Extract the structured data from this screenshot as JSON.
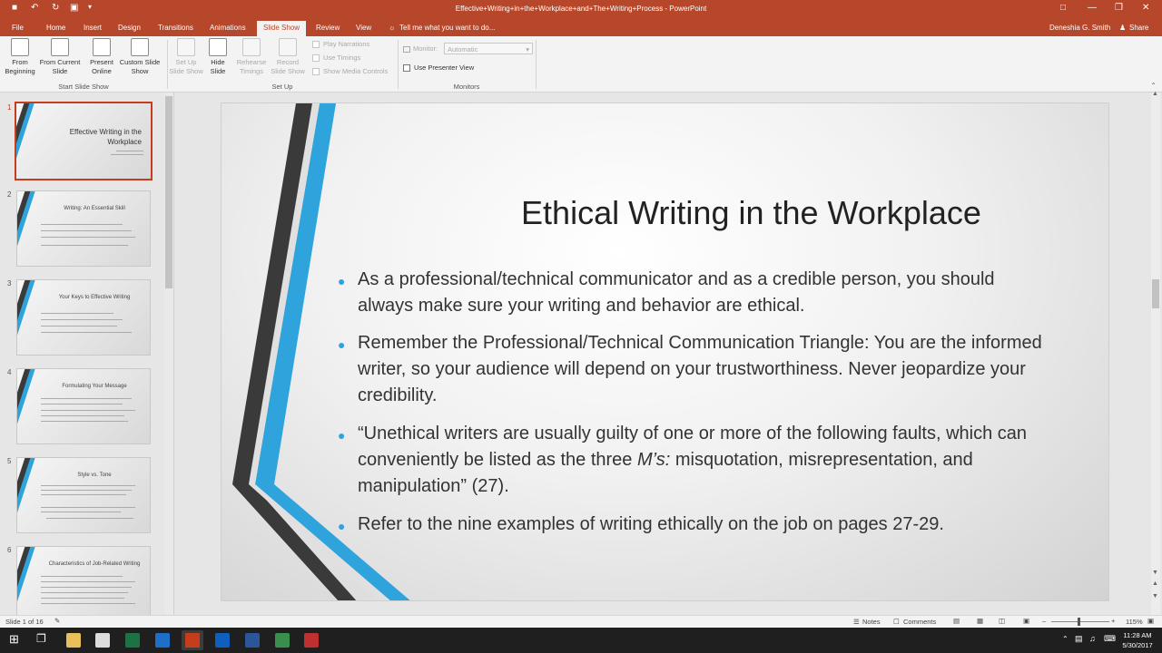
{
  "window": {
    "title": "Effective+Writing+in+the+Workplace+and+The+Writing+Process - PowerPoint",
    "user": "Deneshia G. Smith",
    "share": "Share"
  },
  "tabs": [
    "File",
    "Home",
    "Insert",
    "Design",
    "Transitions",
    "Animations",
    "Slide Show",
    "Review",
    "View"
  ],
  "tell_me": "Tell me what you want to do...",
  "ribbon": {
    "from_beginning": "From Beginning",
    "from_current": "From Current Slide",
    "present_online": "Present Online",
    "custom_show": "Custom Slide Show",
    "group1": "Start Slide Show",
    "setup_show": "Set Up Slide Show",
    "hide_slide": "Hide Slide",
    "rehearse": "Rehearse Timings",
    "record": "Record Slide Show",
    "play_narrations": "Play Narrations",
    "use_timings": "Use Timings",
    "show_media": "Show Media Controls",
    "group2": "Set Up",
    "monitor_label": "Monitor:",
    "monitor_value": "Automatic",
    "use_presenter": "Use Presenter View",
    "group3": "Monitors"
  },
  "thumbnails": [
    {
      "num": "1",
      "title": "Effective Writing in the Workplace"
    },
    {
      "num": "2",
      "title": "Writing: An Essential Skill"
    },
    {
      "num": "3",
      "title": "Your Keys to Effective Writing"
    },
    {
      "num": "4",
      "title": "Formulating Your Message"
    },
    {
      "num": "5",
      "title": "Style vs. Tone"
    },
    {
      "num": "6",
      "title": "Characteristics of Job-Related Writing"
    }
  ],
  "slide": {
    "title": "Ethical Writing in the Workplace",
    "b1": "As a professional/technical communicator and as a credible person, you should always make sure your writing and behavior are ethical.",
    "b2": "Remember the Professional/Technical Communication Triangle: You are the informed writer, so your audience will depend on your trustworthiness. Never jeopardize your credibility.",
    "b3a": "“Unethical writers are usually guilty of one or more of the following faults, which can conveniently be listed as the three ",
    "b3i": "M’s:",
    "b3b": " misquotation, misrepresentation, and manipulation” (27).",
    "b4": "Refer to the nine examples of writing ethically on the job on pages 27-29."
  },
  "status": {
    "slide_info": "Slide 1 of 16",
    "notes": "Notes",
    "comments": "Comments",
    "zoom": "115%"
  },
  "clock": {
    "time": "11:28 AM",
    "date": "5/30/2017"
  },
  "colors": {
    "accent": "#b7472a",
    "stripe_blue": "#2ea3dc",
    "stripe_dark": "#3a3a3a"
  }
}
